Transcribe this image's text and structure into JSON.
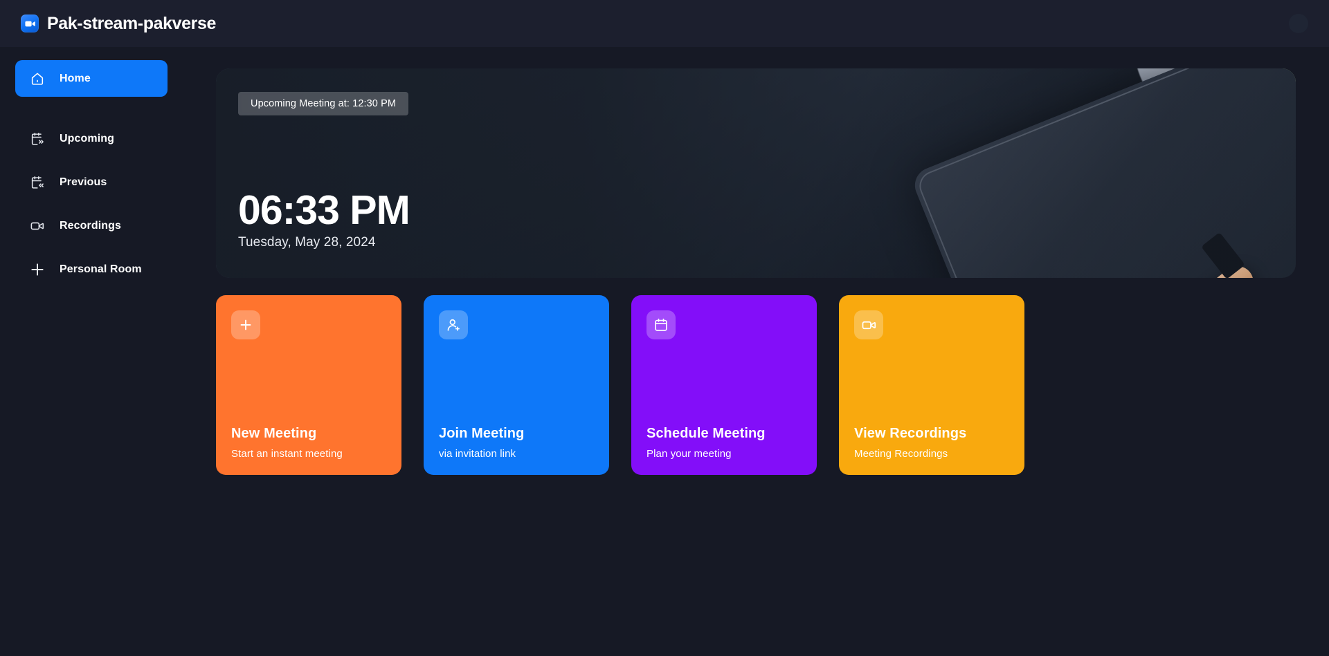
{
  "navbar": {
    "brand_title": "Pak-stream-pakverse",
    "logo_icon": "video-camera-icon",
    "avatar_icon": "user-avatar"
  },
  "sidebar": {
    "items": [
      {
        "label": "Home",
        "icon": "home-icon",
        "key": "home",
        "active": true
      },
      {
        "label": "Upcoming",
        "icon": "calendar-next-icon",
        "key": "upcoming",
        "active": false
      },
      {
        "label": "Previous",
        "icon": "calendar-prev-icon",
        "key": "previous",
        "active": false
      },
      {
        "label": "Recordings",
        "icon": "video-camera-icon",
        "key": "recordings",
        "active": false
      },
      {
        "label": "Personal Room",
        "icon": "plus-icon",
        "key": "personal-room",
        "active": false
      }
    ]
  },
  "hero": {
    "badge": "Upcoming Meeting at: 12:30 PM",
    "time": "06:33 PM",
    "date": "Tuesday, May 28, 2024"
  },
  "cards": [
    {
      "title": "New Meeting",
      "subtitle": "Start an instant meeting",
      "icon": "plus-icon",
      "color": "#FF742E",
      "key": "new-meeting"
    },
    {
      "title": "Join Meeting",
      "subtitle": "via invitation link",
      "icon": "user-plus-icon",
      "color": "#0E78F9",
      "key": "join-meeting"
    },
    {
      "title": "Schedule Meeting",
      "subtitle": "Plan your meeting",
      "icon": "calendar-icon",
      "color": "#830EF9",
      "key": "schedule-meeting"
    },
    {
      "title": "View Recordings",
      "subtitle": "Meeting Recordings",
      "icon": "video-camera-icon",
      "color": "#F9A90E",
      "key": "view-recordings"
    }
  ],
  "theme": {
    "background": "#161925",
    "navbar_background": "#1c1f2e",
    "accent": "#0E78F9",
    "text_primary": "#FFFFFF"
  }
}
